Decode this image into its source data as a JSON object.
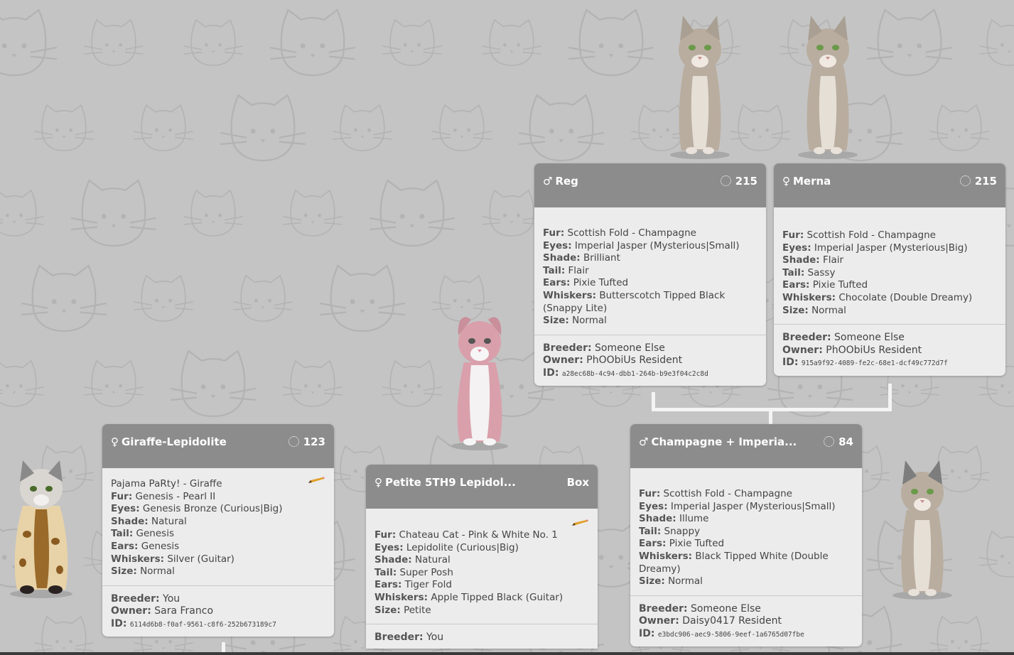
{
  "cards": {
    "reg": {
      "sex_symbol": "♂",
      "name": "Reg",
      "score": "215",
      "fields": [
        {
          "label": "Fur:",
          "value": "Scottish Fold - Champagne"
        },
        {
          "label": "Eyes:",
          "value": "Imperial Jasper (Mysterious|Small)"
        },
        {
          "label": "Shade:",
          "value": "Brilliant"
        },
        {
          "label": "Tail:",
          "value": "Flair"
        },
        {
          "label": "Ears:",
          "value": "Pixie Tufted"
        },
        {
          "label": "Whiskers:",
          "value": "Butterscotch Tipped Black (Snappy Lite)"
        },
        {
          "label": "Size:",
          "value": "Normal"
        }
      ],
      "breeder_label": "Breeder:",
      "breeder": "Someone Else",
      "owner_label": "Owner:",
      "owner": "PhOObiUs Resident",
      "id_label": "ID:",
      "id": "a28ec68b-4c94-dbb1-264b-b9e3f04c2c8d"
    },
    "merna": {
      "sex_symbol": "♀",
      "name": "Merna",
      "score": "215",
      "fields": [
        {
          "label": "Fur:",
          "value": "Scottish Fold - Champagne"
        },
        {
          "label": "Eyes:",
          "value": "Imperial Jasper (Mysterious|Big)"
        },
        {
          "label": "Shade:",
          "value": "Flair"
        },
        {
          "label": "Tail:",
          "value": "Sassy"
        },
        {
          "label": "Ears:",
          "value": "Pixie Tufted"
        },
        {
          "label": "Whiskers:",
          "value": "Chocolate (Double Dreamy)"
        },
        {
          "label": "Size:",
          "value": "Normal"
        }
      ],
      "breeder_label": "Breeder:",
      "breeder": "Someone Else",
      "owner_label": "Owner:",
      "owner": "PhOObiUs Resident",
      "id_label": "ID:",
      "id": "915a9f92-4089-fe2c-68e1-dcf49c772d7f"
    },
    "giraffe": {
      "sex_symbol": "♀",
      "name": "Giraffe-Lepidolite",
      "score": "123",
      "subtitle": "Pajama PaRty! - Giraffe",
      "fields": [
        {
          "label": "Fur:",
          "value": "Genesis - Pearl II"
        },
        {
          "label": "Eyes:",
          "value": "Genesis Bronze (Curious|Big)"
        },
        {
          "label": "Shade:",
          "value": "Natural"
        },
        {
          "label": "Tail:",
          "value": "Genesis"
        },
        {
          "label": "Ears:",
          "value": "Genesis"
        },
        {
          "label": "Whiskers:",
          "value": "Silver (Guitar)"
        },
        {
          "label": "Size:",
          "value": "Normal"
        }
      ],
      "breeder_label": "Breeder:",
      "breeder": "You",
      "owner_label": "Owner:",
      "owner": "Sara Franco",
      "id_label": "ID:",
      "id": "6114d6b8-f0af-9561-c8f6-252b673189c7"
    },
    "petite": {
      "sex_symbol": "♀",
      "name": "Petite 5TH9 Lepidol...",
      "score": "Box",
      "fields": [
        {
          "label": "Fur:",
          "value": "Chateau Cat - Pink & White No. 1"
        },
        {
          "label": "Eyes:",
          "value": "Lepidolite (Curious|Big)"
        },
        {
          "label": "Shade:",
          "value": "Natural"
        },
        {
          "label": "Tail:",
          "value": "Super Posh"
        },
        {
          "label": "Ears:",
          "value": "Tiger Fold"
        },
        {
          "label": "Whiskers:",
          "value": "Apple Tipped Black (Guitar)"
        },
        {
          "label": "Size:",
          "value": "Petite"
        }
      ],
      "breeder_label": "Breeder:",
      "breeder": "You"
    },
    "champagne": {
      "sex_symbol": "♂",
      "name": "Champagne + Imperia...",
      "score": "84",
      "fields": [
        {
          "label": "Fur:",
          "value": "Scottish Fold - Champagne"
        },
        {
          "label": "Eyes:",
          "value": "Imperial Jasper (Mysterious|Small)"
        },
        {
          "label": "Shade:",
          "value": "Illume"
        },
        {
          "label": "Tail:",
          "value": "Snappy"
        },
        {
          "label": "Ears:",
          "value": "Pixie Tufted"
        },
        {
          "label": "Whiskers:",
          "value": "Black Tipped White (Double Dreamy)"
        },
        {
          "label": "Size:",
          "value": "Normal"
        }
      ],
      "breeder_label": "Breeder:",
      "breeder": "Someone Else",
      "owner_label": "Owner:",
      "owner": "Daisy0417 Resident",
      "id_label": "ID:",
      "id": "e3bdc906-aec9-5806-9eef-1a6765d07fbe"
    }
  },
  "icons": {
    "score": "spinner-icon",
    "edit": "pencil-icon",
    "male": "male-symbol-icon",
    "female": "female-symbol-icon"
  },
  "colors": {
    "background": "#c4c4c4",
    "header": "#8c8c8c",
    "card": "#ececec",
    "tabby": "#b9ad9f",
    "pink": "#d9a0ab",
    "giraffe": "#c9a060"
  }
}
